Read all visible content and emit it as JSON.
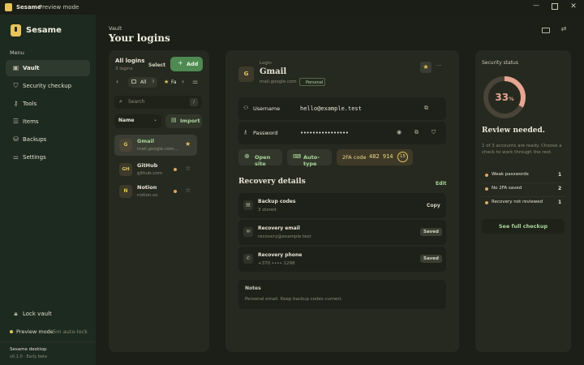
{
  "titlebar": {
    "app_name": "Sesame",
    "separator": "/",
    "mode": "Preview mode"
  },
  "brand": {
    "name": "Sesame"
  },
  "sidebar": {
    "section_label": "Menu",
    "items": [
      {
        "label": "Vault",
        "icon": "vault-icon",
        "active": true
      },
      {
        "label": "Security checkup",
        "icon": "shield-icon"
      },
      {
        "label": "Tools",
        "icon": "key-icon"
      },
      {
        "label": "Items",
        "icon": "list-icon"
      },
      {
        "label": "Backups",
        "icon": "backup-icon"
      },
      {
        "label": "Settings",
        "icon": "sliders-icon"
      }
    ],
    "lock_label": "Lock vault",
    "preview_label": "Preview mode",
    "auto_lock": "· 5m auto-lock",
    "footer_title": "Sesame desktop",
    "footer_version": "v0.1.0 · Early beta"
  },
  "header": {
    "breadcrumb": "Vault",
    "title": "Your logins"
  },
  "list_panel": {
    "title": "All logins",
    "count": "3 logins",
    "select_label": "Select",
    "add_label": "Add",
    "filters": [
      {
        "label": "All",
        "icon": "folder-icon",
        "count": "3"
      },
      {
        "label": "Fa",
        "icon": "star-icon"
      }
    ],
    "search_placeholder": "Search",
    "search_shortcut": "/",
    "sort_label": "Name",
    "import_label": "Import",
    "items": [
      {
        "initials": "G",
        "name": "Gmail",
        "url": "mail.google.com...",
        "selected": true,
        "starred": true,
        "warning": false
      },
      {
        "initials": "GH",
        "name": "GitHub",
        "url": "github.com",
        "selected": false,
        "starred": false,
        "warning": true
      },
      {
        "initials": "N",
        "name": "Notion",
        "url": "notion.so",
        "selected": false,
        "starred": false,
        "warning": true
      }
    ]
  },
  "detail": {
    "type_label": "Login",
    "initial": "G",
    "name": "Gmail",
    "url": "mail.google.com",
    "tag": "Personal",
    "more": "···",
    "username_label": "Username",
    "username_value": "hello@example.test",
    "password_label": "Password",
    "password_value": "••••••••••••••••",
    "open_site": "Open site",
    "auto_type": "Auto-type",
    "twofa_label": "2FA code",
    "twofa_code": "482 914",
    "twofa_timer": "15",
    "recovery_title": "Recovery details",
    "edit_label": "Edit",
    "recovery": [
      {
        "icon": "document-icon",
        "title": "Backup codes",
        "sub": "3 stored",
        "action": "Copy"
      },
      {
        "icon": "mail-icon",
        "title": "Recovery email",
        "sub": "recovery@example.test",
        "action": "Saved"
      },
      {
        "icon": "phone-icon",
        "title": "Recovery phone",
        "sub": "+370 •••• 1298",
        "action": "Saved"
      }
    ],
    "notes_label": "Notes",
    "notes_text": "Personal email. Keep backup codes current."
  },
  "security": {
    "title": "Security status",
    "percent": 33,
    "percent_number": "33",
    "percent_sign": "%",
    "headline": "Review needed.",
    "description": "1 of 3 accounts are ready. Choose a check to work through the rest.",
    "issues": [
      {
        "label": "Weak passwords",
        "count": "1"
      },
      {
        "label": "No 2FA saved",
        "count": "2"
      },
      {
        "label": "Recovery not reviewed",
        "count": "1"
      }
    ],
    "cta": "See full checkup"
  },
  "colors": {
    "accent": "#a9d79b",
    "gold": "#e8c35a",
    "ring_fill": "#e8a592",
    "ring_track": "#4a4438",
    "warning": "#e0a65a"
  }
}
